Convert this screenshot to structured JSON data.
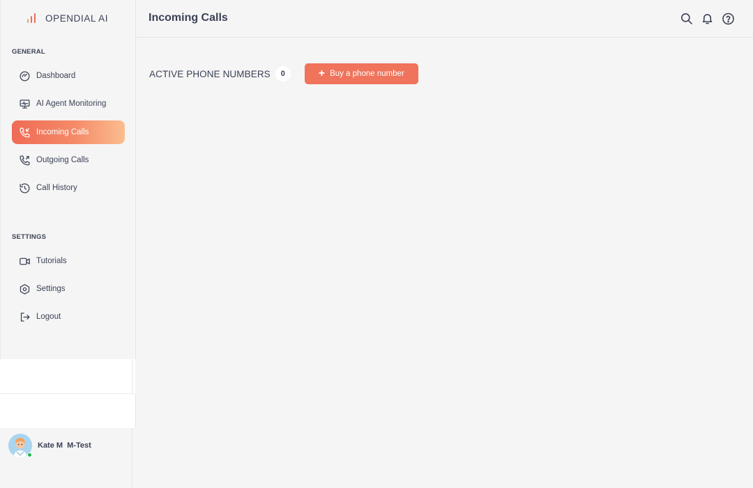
{
  "brand": {
    "name": "OPENDIAL AI",
    "colors": {
      "bar1": "#f4a25f",
      "bar2": "#ef6b55",
      "bar3": "#ef6b55"
    }
  },
  "sidebar": {
    "general_label": "GENERAL",
    "settings_label": "SETTINGS",
    "general_items": [
      {
        "label": "Dashboard",
        "icon": "dashboard-gauge-icon"
      },
      {
        "label": "AI Agent Monitoring",
        "icon": "monitor-icon"
      },
      {
        "label": "Incoming Calls",
        "icon": "incoming-call-icon",
        "active": true
      },
      {
        "label": "Outgoing Calls",
        "icon": "outgoing-call-icon"
      },
      {
        "label": "Call History",
        "icon": "history-icon"
      }
    ],
    "settings_items": [
      {
        "label": "Tutorials",
        "icon": "video-camera-icon"
      },
      {
        "label": "Settings",
        "icon": "settings-hexagon-icon"
      },
      {
        "label": "Logout",
        "icon": "logout-icon"
      }
    ]
  },
  "header": {
    "title": "Incoming Calls",
    "icons": [
      "search-icon",
      "bell-icon",
      "help-icon"
    ]
  },
  "main": {
    "active_numbers_label": "ACTIVE PHONE NUMBERS",
    "active_numbers_count": "0",
    "buy_button_label": "Buy a phone number"
  },
  "user": {
    "name": "Kate M  M-Test",
    "status": "online",
    "status_color": "#27b34b"
  },
  "colors": {
    "accent": "#f0735b",
    "text": "#3b4256",
    "background": "#f5f5f5"
  }
}
